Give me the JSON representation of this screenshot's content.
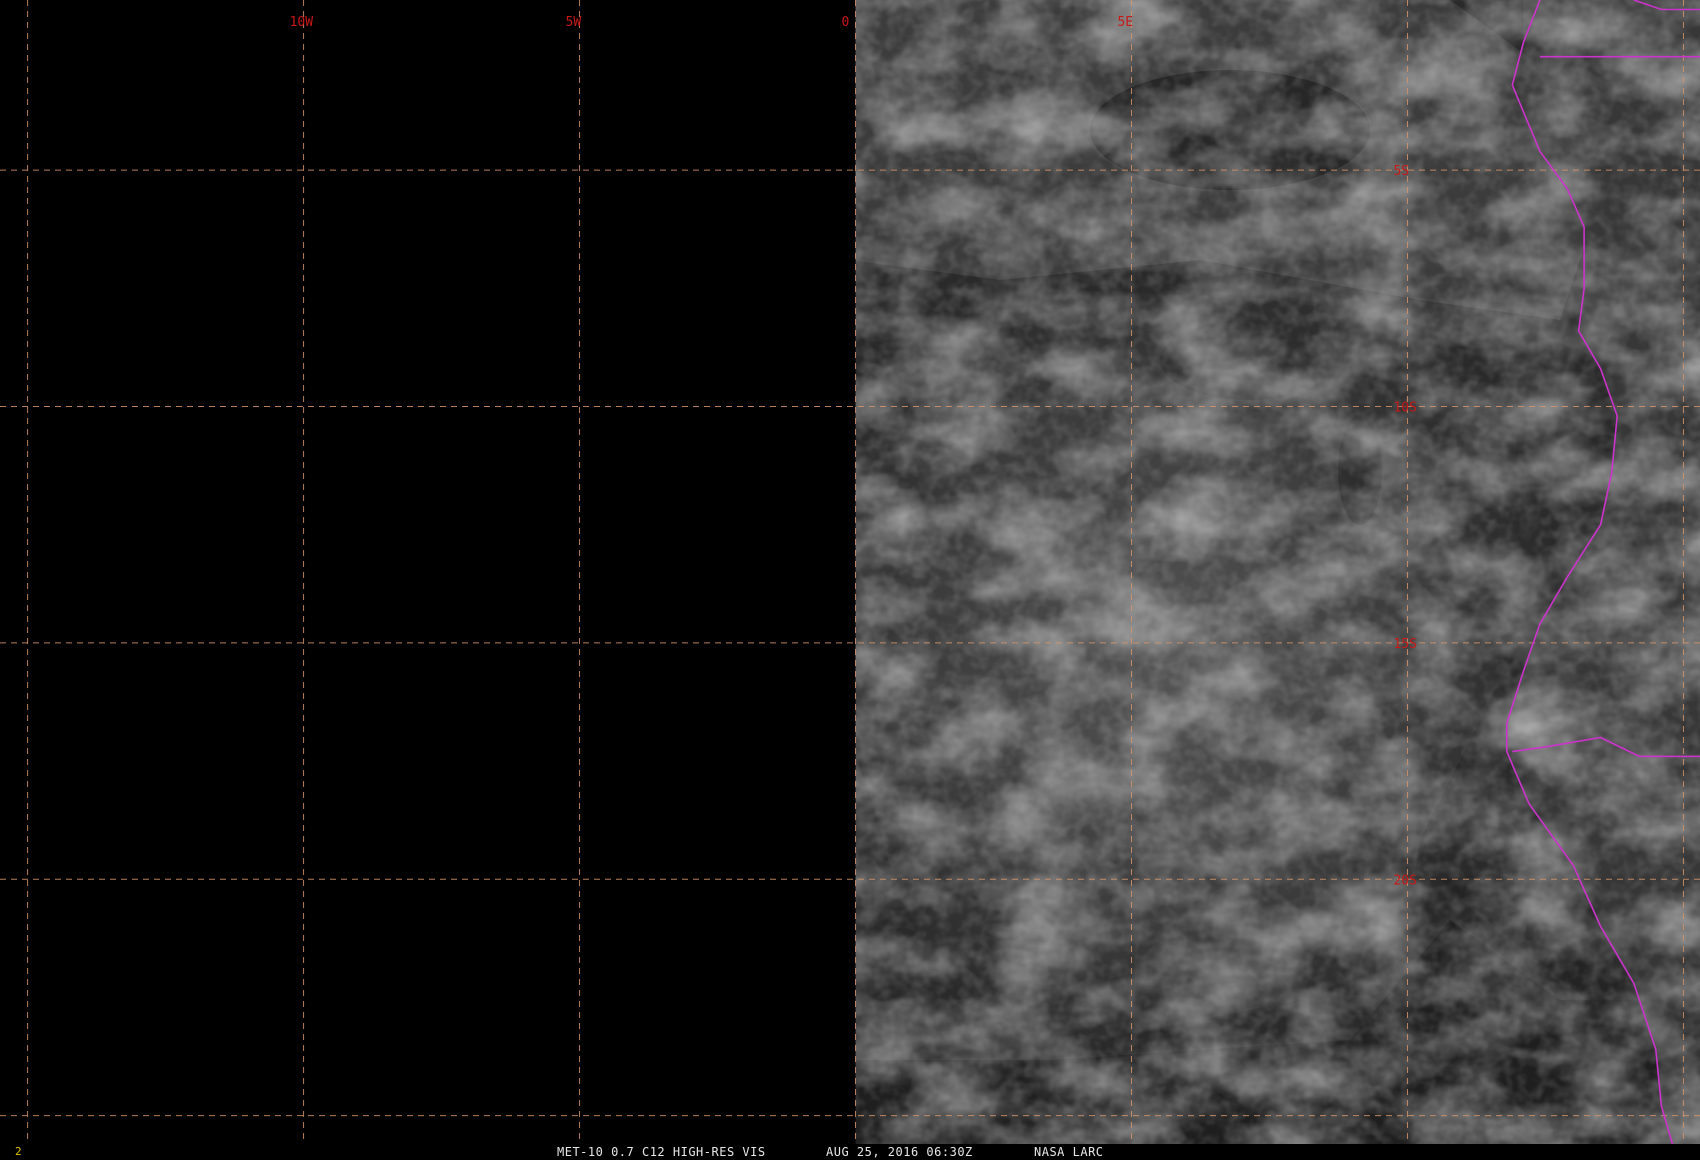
{
  "colors": {
    "background": "#000000",
    "gridline": "#d8946a",
    "grid_label": "#c81818",
    "coastline": "#cc33cc",
    "status_text": "#e8e8e8",
    "frame_number": "#e0c000"
  },
  "map": {
    "projection": "equirectangular",
    "lon_range": [
      -15.5,
      15.3
    ],
    "lat_range": [
      -1.4,
      -25.6
    ],
    "grid_interval_deg": 5,
    "meridians": [
      {
        "lon": -15,
        "label": ""
      },
      {
        "lon": -10,
        "label": "10W"
      },
      {
        "lon": -5,
        "label": "5W"
      },
      {
        "lon": 0,
        "label": "0"
      },
      {
        "lon": 5,
        "label": "5E"
      },
      {
        "lon": 10,
        "label": ""
      },
      {
        "lon": 15,
        "label": ""
      }
    ],
    "parallels": [
      {
        "lat": -5,
        "label": "5S"
      },
      {
        "lat": -10,
        "label": "10S"
      },
      {
        "lat": -15,
        "label": "15S"
      },
      {
        "lat": -20,
        "label": "20S"
      },
      {
        "lat": -25,
        "label": ""
      }
    ],
    "swath_west_edge_lon": 0,
    "coastline": [
      [
        12.1,
        -2.3
      ],
      [
        11.9,
        -3.2
      ],
      [
        12.4,
        -4.6
      ],
      [
        12.9,
        -5.4
      ],
      [
        13.2,
        -6.2
      ],
      [
        13.2,
        -7.5
      ],
      [
        13.1,
        -8.4
      ],
      [
        13.5,
        -9.2
      ],
      [
        13.8,
        -10.2
      ],
      [
        13.7,
        -11.4
      ],
      [
        13.5,
        -12.5
      ],
      [
        12.9,
        -13.6
      ],
      [
        12.4,
        -14.6
      ],
      [
        12.1,
        -15.6
      ],
      [
        11.8,
        -16.7
      ],
      [
        11.8,
        -17.3
      ],
      [
        12.2,
        -18.4
      ],
      [
        13.0,
        -19.7
      ],
      [
        13.5,
        -21.0
      ],
      [
        14.1,
        -22.2
      ],
      [
        14.5,
        -23.6
      ],
      [
        14.6,
        -24.8
      ],
      [
        14.8,
        -25.6
      ]
    ],
    "borders": [
      [
        [
          11.9,
          -17.3
        ],
        [
          12.5,
          -17.2
        ],
        [
          13.5,
          -17.0
        ],
        [
          14.2,
          -17.4
        ],
        [
          15.3,
          -17.4
        ]
      ],
      [
        [
          12.1,
          -2.3
        ],
        [
          12.4,
          -1.4
        ]
      ],
      [
        [
          14.1,
          -1.4
        ],
        [
          14.6,
          -1.6
        ],
        [
          15.3,
          -1.6
        ]
      ],
      [
        [
          12.4,
          -2.6
        ],
        [
          13.5,
          -2.6
        ],
        [
          14.6,
          -2.6
        ],
        [
          15.3,
          -2.6
        ]
      ]
    ]
  },
  "status_bar": {
    "frame_number": "2",
    "product": "MET-10 0.7 C12 HIGH-RES VIS",
    "timestamp": "AUG 25, 2016 06:30Z",
    "source": "NASA LARC"
  }
}
